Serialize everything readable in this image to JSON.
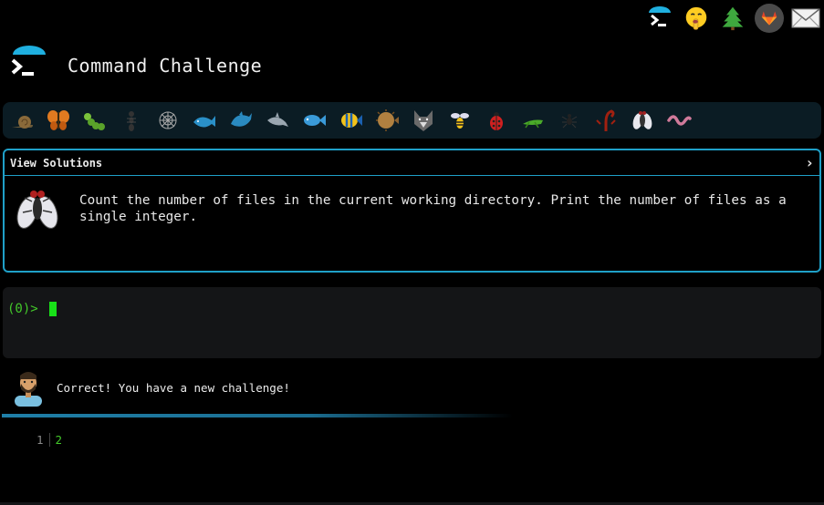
{
  "app": {
    "title": "Command Challenge",
    "top_icons": [
      "terminal-icon",
      "shush-face-icon",
      "tree-icon",
      "gitlab-icon",
      "mail-icon"
    ]
  },
  "creatures": [
    "snail",
    "butterfly",
    "caterpillar",
    "ant",
    "spider-web",
    "whale",
    "dolphin",
    "dolphin-gray",
    "fish",
    "tropical-fish",
    "pufferfish",
    "wolf",
    "bee",
    "ladybug",
    "cricket",
    "spider",
    "scorpion",
    "fly",
    "worm"
  ],
  "challenge": {
    "header": "View Solutions",
    "chevron": "›",
    "description": "Count the number of files in the current working directory. Print the number of files as a single integer.",
    "icon": "fly-icon"
  },
  "terminal": {
    "prompt": "(0)>"
  },
  "feedback": {
    "message": "Correct! You have a new challenge!"
  },
  "output": {
    "lines": [
      {
        "number": "1",
        "value": "2"
      }
    ]
  },
  "colors": {
    "accent": "#1fa0c8",
    "prompt_green": "#43c92a",
    "cursor_green": "#18e018",
    "background": "#000000",
    "creature_bar": "#0b1c24",
    "terminal_bg": "#141517"
  }
}
